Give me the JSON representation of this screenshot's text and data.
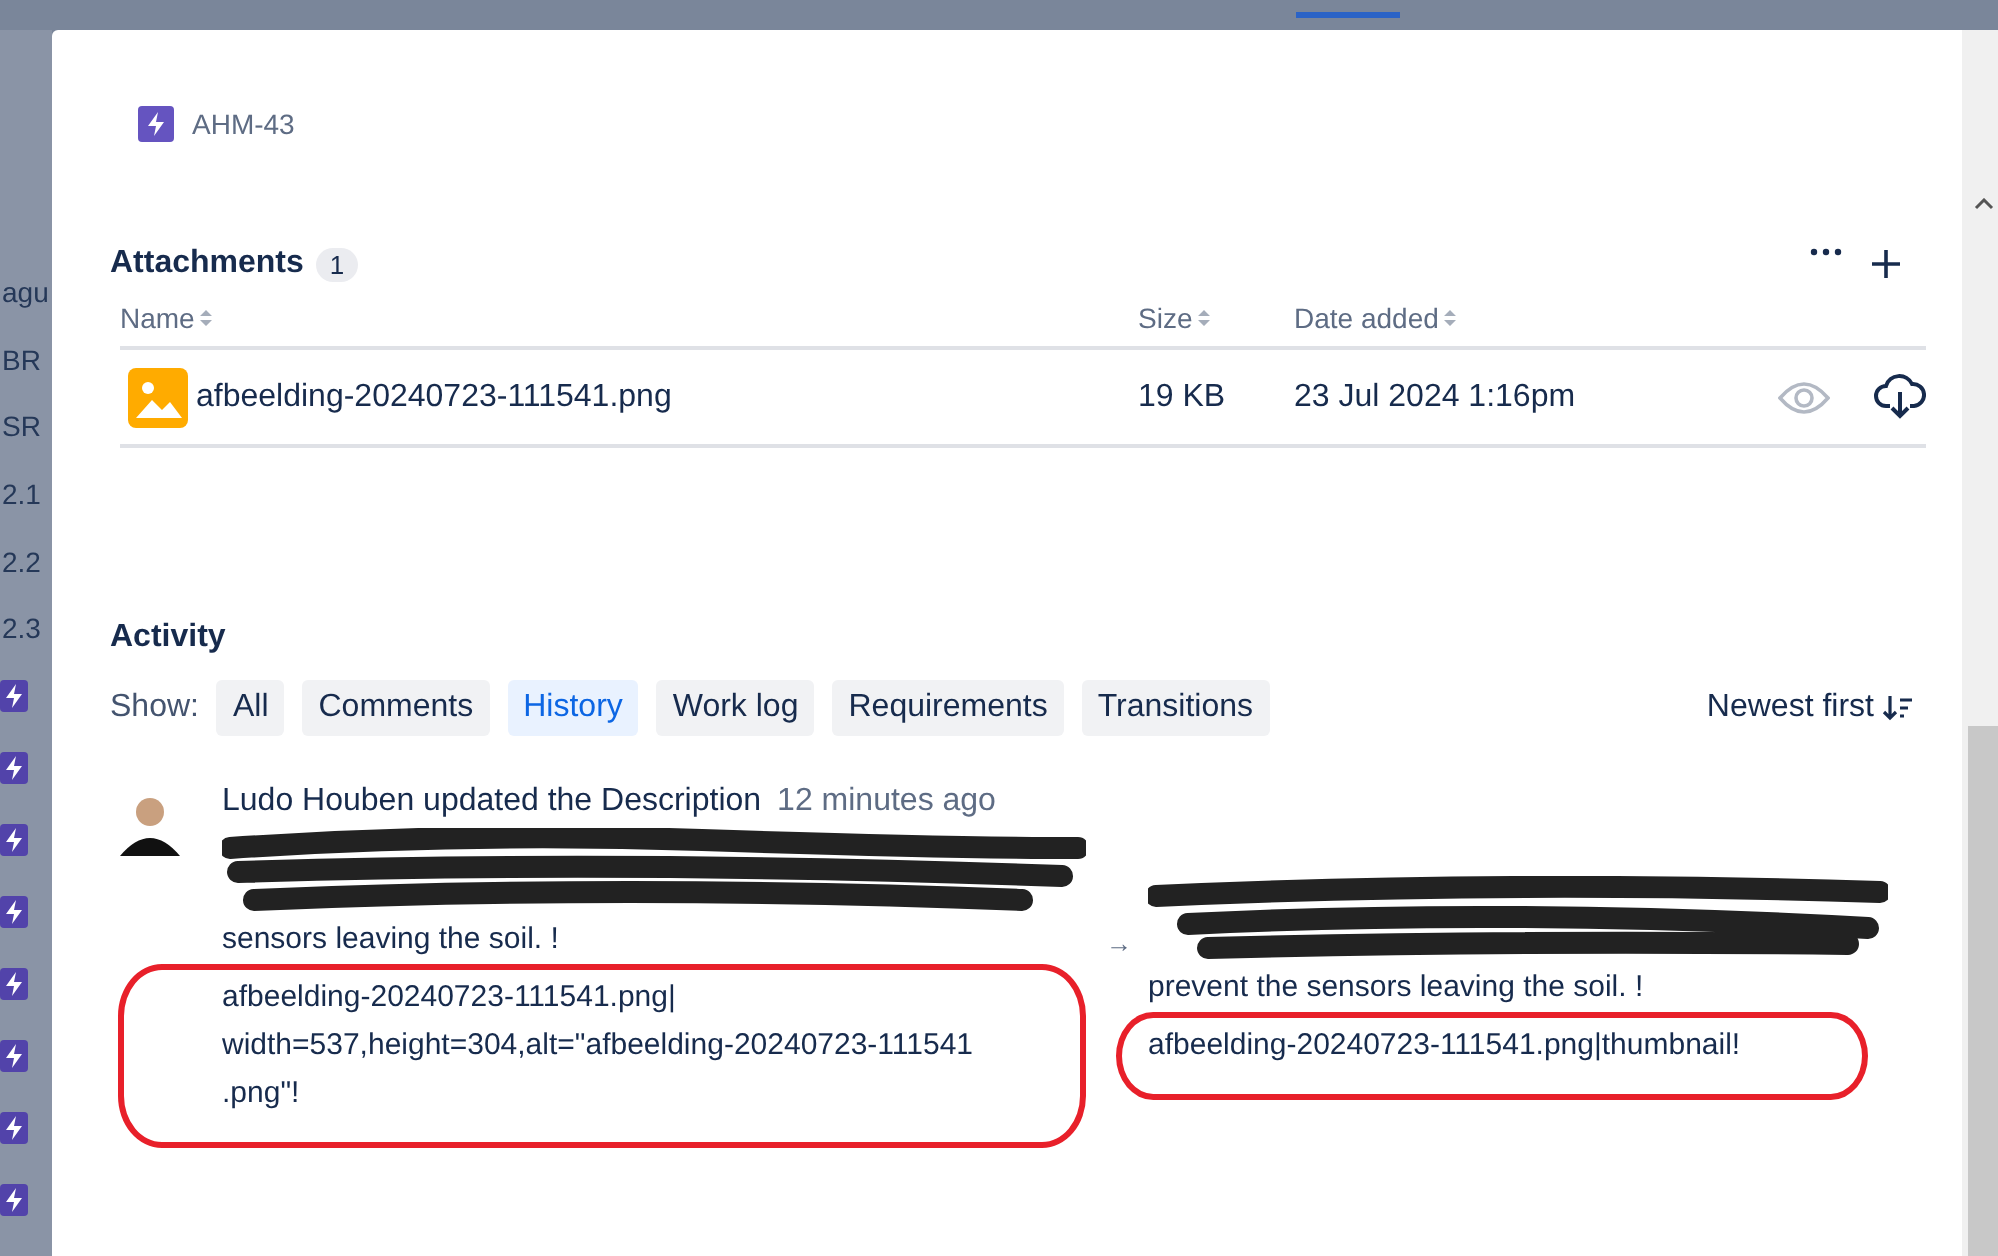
{
  "background": {
    "sidebar_fragments": [
      "agu",
      "BR",
      "SR",
      "2.1",
      "2.2",
      "2.3"
    ]
  },
  "issue": {
    "key": "AHM-43"
  },
  "attachments": {
    "title": "Attachments",
    "count": "1",
    "columns": [
      {
        "label": "Name"
      },
      {
        "label": "Size"
      },
      {
        "label": "Date added"
      }
    ],
    "rows": [
      {
        "name": "afbeelding-20240723-111541.png",
        "size": "19 KB",
        "date": "23 Jul 2024 1:16pm"
      }
    ]
  },
  "activity": {
    "title": "Activity",
    "show_label": "Show:",
    "filters": [
      {
        "label": "All",
        "selected": false
      },
      {
        "label": "Comments",
        "selected": false
      },
      {
        "label": "History",
        "selected": true
      },
      {
        "label": "Work log",
        "selected": false
      },
      {
        "label": "Requirements",
        "selected": false
      },
      {
        "label": "Transitions",
        "selected": false
      }
    ],
    "sort": "Newest first",
    "entries": [
      {
        "author": "Ludo Houben",
        "action": "updated the Description",
        "time": "12 minutes ago",
        "old_lead": "sensors leaving the soil. !",
        "old_value": "afbeelding-20240723-111541.png| width=537,height=304,alt=\"afbeelding-20240723-111541 .png\"!",
        "arrow": "→",
        "new_lead": "prevent the sensors leaving the soil. !",
        "new_value": "afbeelding-20240723-111541.png|thumbnail!"
      }
    ]
  }
}
